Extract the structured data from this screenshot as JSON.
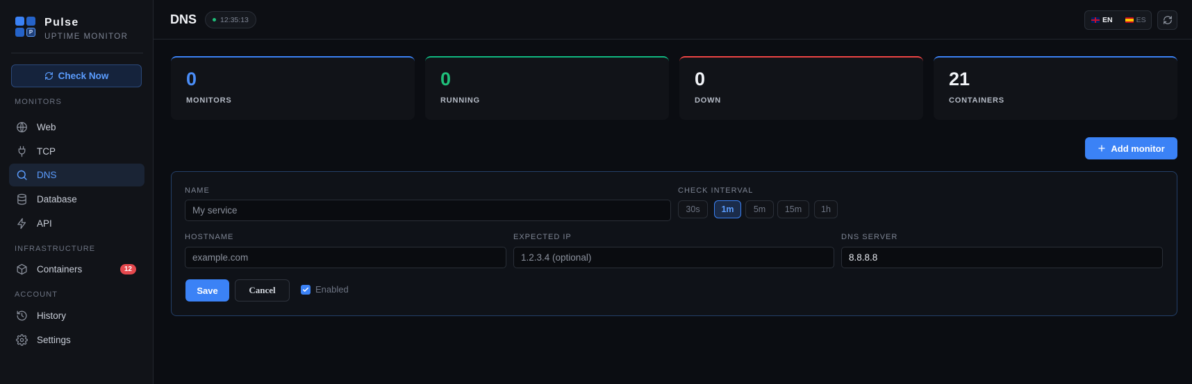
{
  "brand": {
    "name": "Pulse",
    "subtitle": "UPTIME MONITOR"
  },
  "sidebar": {
    "check_now": "Check Now",
    "sections": {
      "monitors": "MONITORS",
      "infrastructure": "INFRASTRUCTURE",
      "account": "ACCOUNT"
    },
    "items": {
      "web": "Web",
      "tcp": "TCP",
      "dns": "DNS",
      "database": "Database",
      "api": "API",
      "containers": "Containers",
      "containers_badge": "12",
      "history": "History",
      "settings": "Settings"
    },
    "active_item": "DNS"
  },
  "header": {
    "title": "DNS",
    "clock": "12:35:13",
    "languages": {
      "en": "EN",
      "es": "ES",
      "selected": "EN"
    }
  },
  "stats": {
    "monitors": {
      "value": "0",
      "label": "MONITORS",
      "color": "#3b82f6"
    },
    "running": {
      "value": "0",
      "label": "RUNNING",
      "color": "#10b981"
    },
    "down": {
      "value": "0",
      "label": "DOWN",
      "color": "#ef4444"
    },
    "containers": {
      "value": "21",
      "label": "CONTAINERS",
      "color": "#3b82f6"
    }
  },
  "actions": {
    "add_monitor": "Add monitor"
  },
  "form": {
    "name_label": "NAME",
    "name_placeholder": "My service",
    "interval_label": "CHECK INTERVAL",
    "intervals": [
      "30s",
      "1m",
      "5m",
      "15m",
      "1h"
    ],
    "interval_selected": "1m",
    "hostname_label": "HOSTNAME",
    "hostname_placeholder": "example.com",
    "expected_ip_label": "EXPECTED IP",
    "expected_ip_placeholder": "1.2.3.4 (optional)",
    "dns_server_label": "DNS SERVER",
    "dns_server_value": "8.8.8.8",
    "save": "Save",
    "cancel": "Cancel",
    "enabled_label": "Enabled",
    "enabled": true
  },
  "colors": {
    "accent": "#3b82f6",
    "background": "#0b0d12",
    "badge": "#e5484d"
  }
}
